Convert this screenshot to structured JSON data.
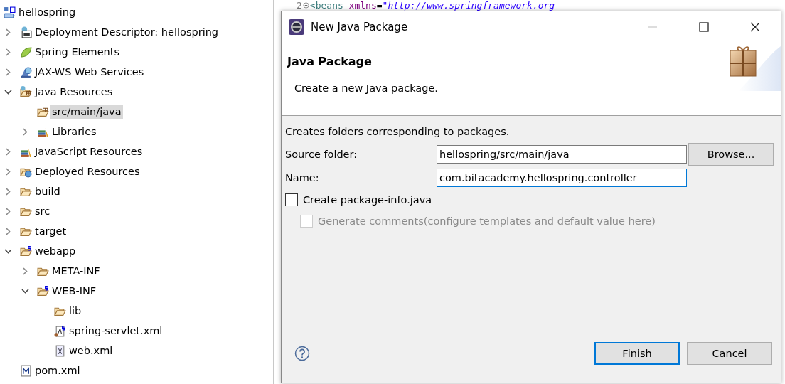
{
  "explorer": {
    "project": {
      "label": "hellospring",
      "kind": "project",
      "selected": false,
      "children": [
        {
          "label": "Deployment Descriptor: hellospring",
          "kind": "descriptor",
          "expanded": false,
          "selected": false
        },
        {
          "label": "Spring Elements",
          "kind": "spring",
          "expanded": false,
          "selected": false
        },
        {
          "label": "JAX-WS Web Services",
          "kind": "webservice",
          "expanded": false,
          "selected": false
        },
        {
          "label": "Java Resources",
          "kind": "javares",
          "expanded": true,
          "selected": false,
          "children": [
            {
              "label": "src/main/java",
              "kind": "package",
              "selected": true
            },
            {
              "label": "Libraries",
              "kind": "library",
              "expanded": false,
              "selected": false
            }
          ]
        },
        {
          "label": "JavaScript Resources",
          "kind": "library",
          "expanded": false,
          "selected": false
        },
        {
          "label": "Deployed Resources",
          "kind": "deployed",
          "expanded": false,
          "selected": false
        },
        {
          "label": "build",
          "kind": "folder",
          "expanded": false,
          "selected": false
        },
        {
          "label": "src",
          "kind": "folder",
          "expanded": false,
          "selected": false
        },
        {
          "label": "target",
          "kind": "folder",
          "expanded": false,
          "selected": false
        },
        {
          "label": "webapp",
          "kind": "springfolder",
          "expanded": true,
          "selected": false,
          "children": [
            {
              "label": "META-INF",
              "kind": "folder",
              "expanded": false,
              "selected": false
            },
            {
              "label": "WEB-INF",
              "kind": "springfolder",
              "expanded": true,
              "selected": false,
              "children": [
                {
                  "label": "lib",
                  "kind": "folder",
                  "selected": false
                },
                {
                  "label": "spring-servlet.xml",
                  "kind": "springxml",
                  "selected": false
                },
                {
                  "label": "web.xml",
                  "kind": "xml",
                  "selected": false
                }
              ]
            }
          ]
        },
        {
          "label": "pom.xml",
          "kind": "maven",
          "selected": false
        }
      ]
    }
  },
  "editor": {
    "line_number": "2",
    "tokens": [
      {
        "kind": "tag",
        "text": "<beans"
      },
      {
        "kind": "attr",
        "text": "xmlns"
      },
      {
        "kind": "plain",
        "text": "="
      },
      {
        "kind": "string",
        "text": "\"http://www.springframework.org"
      }
    ]
  },
  "dialog": {
    "title": "New Java Package",
    "header": {
      "title": "Java Package",
      "message": "Create a new Java package."
    },
    "description": "Creates folders corresponding to packages.",
    "fields": [
      {
        "label": "Source folder:",
        "value": "hellospring/src/main/java",
        "focused": false,
        "button": "Browse..."
      },
      {
        "label": "Name:",
        "value": "com.bitacademy.hellospring.controller",
        "focused": true
      }
    ],
    "options": [
      {
        "label": "Create package-info.java",
        "checked": false,
        "disabled": false
      },
      {
        "label": "Generate comments",
        "link": "(configure templates and default value here)",
        "checked": false,
        "disabled": true
      }
    ],
    "buttons": [
      {
        "label": "Finish",
        "default": true
      },
      {
        "label": "Cancel",
        "default": false
      }
    ]
  }
}
